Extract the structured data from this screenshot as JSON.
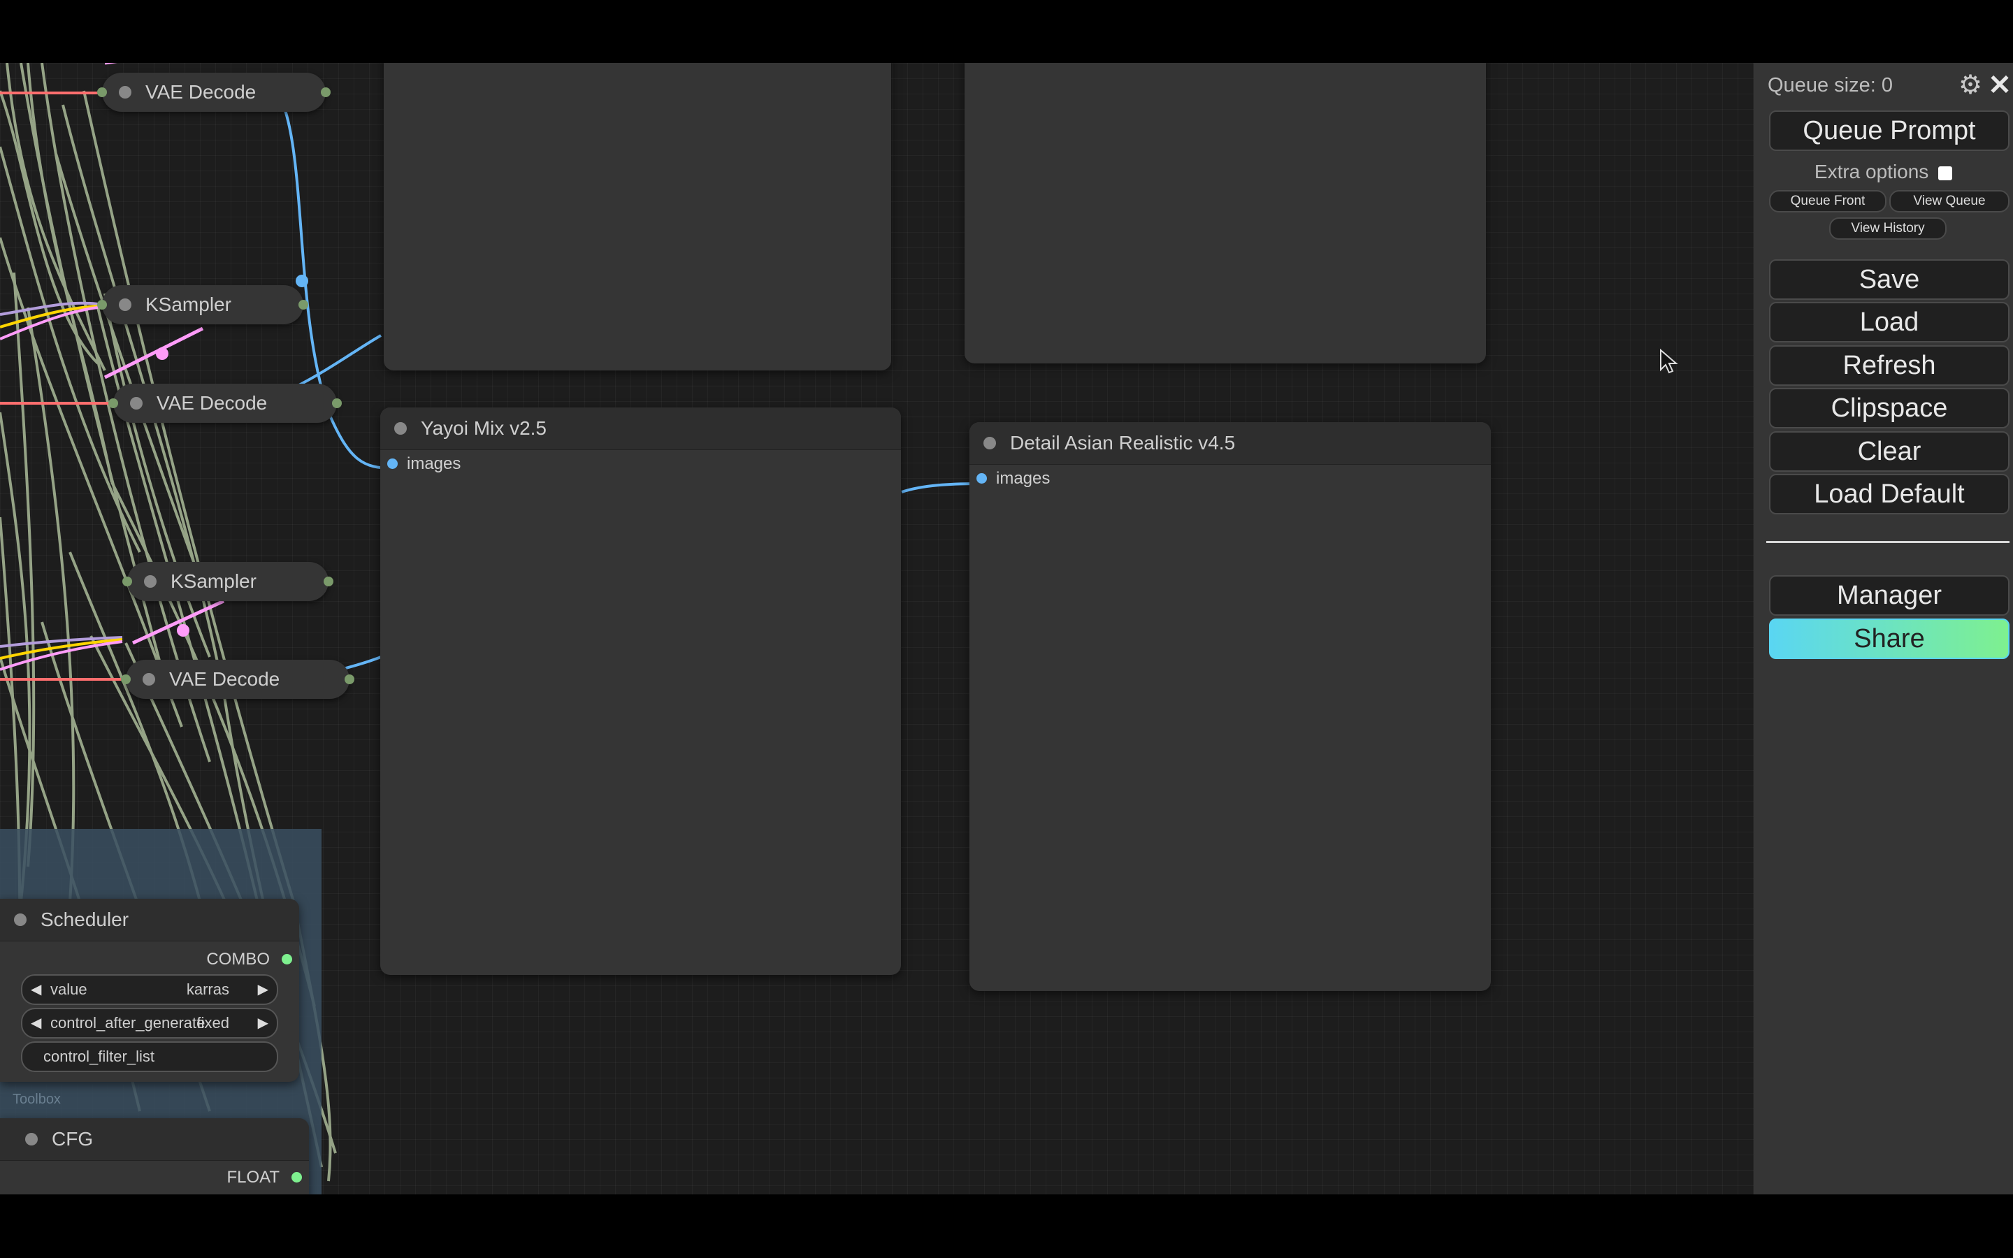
{
  "canvas": {
    "collapsed_nodes": [
      {
        "title": "VAE Decode"
      },
      {
        "title": "KSampler"
      },
      {
        "title": "VAE Decode"
      },
      {
        "title": "KSampler"
      },
      {
        "title": "VAE Decode"
      }
    ],
    "preview_nodes": [
      {
        "title": "Yayoi Mix v2.5",
        "input_label": "images"
      },
      {
        "title": "Detail Asian Realistic v4.5",
        "input_label": "images"
      }
    ],
    "scheduler_node": {
      "title": "Scheduler",
      "output_label": "COMBO",
      "widgets": [
        {
          "label": "value",
          "value": "karras"
        },
        {
          "label": "control_after_generate",
          "value": "fixed"
        },
        {
          "label": "control_filter_list",
          "value": ""
        }
      ]
    },
    "group_title": "Toolbox",
    "cfg_node": {
      "title": "CFG",
      "output_label": "FLOAT"
    }
  },
  "menu": {
    "queue_size_label": "Queue size: 0",
    "queue_prompt": "Queue Prompt",
    "extra_options": "Extra options",
    "queue_front": "Queue Front",
    "view_queue": "View Queue",
    "view_history": "View History",
    "buttons": [
      "Save",
      "Load",
      "Refresh",
      "Clipspace",
      "Clear",
      "Load Default"
    ],
    "manager": "Manager",
    "share": "Share"
  },
  "colors": {
    "canvas_bg": "#1d1d1d",
    "node_bg": "#353535",
    "menu_bg": "#353535",
    "wire_image": "#64b5f6",
    "wire_latent": "#ff9cf9",
    "wire_vae": "#ff6e6e",
    "wire_model": "#b39ddb",
    "wire_clip": "#ffd500",
    "wire_float": "#aabb99",
    "share_gradient_start": "#5ad6f2",
    "share_gradient_end": "#7ef08f"
  }
}
